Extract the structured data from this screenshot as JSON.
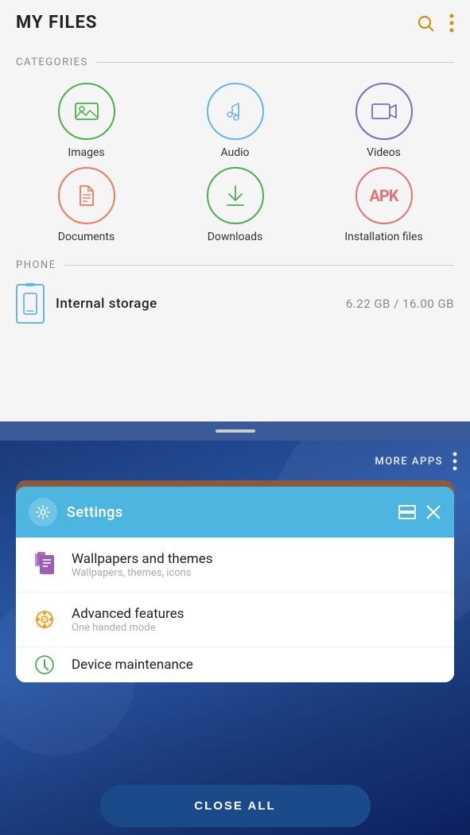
{
  "app": {
    "title": "MY FILES"
  },
  "header": {
    "search_icon": "🔍",
    "more_icon": "⋮"
  },
  "categories_section": {
    "label": "CATEGORIES",
    "items": [
      {
        "id": "images",
        "label": "Images",
        "color": "#4caf50"
      },
      {
        "id": "audio",
        "label": "Audio",
        "color": "#64b5f6"
      },
      {
        "id": "videos",
        "label": "Videos",
        "color": "#7c6bbf"
      },
      {
        "id": "documents",
        "label": "Documents",
        "color": "#ef7b5a"
      },
      {
        "id": "downloads",
        "label": "Downloads",
        "color": "#4caf50"
      },
      {
        "id": "installation",
        "label": "Installation files",
        "color": "#e57373"
      }
    ]
  },
  "phone_section": {
    "label": "PHONE",
    "storage": {
      "name": "Internal storage",
      "used": "6.22 GB",
      "total": "16.00 GB",
      "display": "6.22 GB / 16.00 GB"
    }
  },
  "recent_apps": {
    "more_apps_label": "MORE APPS",
    "settings_card": {
      "title": "Settings",
      "menu_items": [
        {
          "title": "Wallpapers and themes",
          "subtitle": "Wallpapers, themes, icons",
          "icon_color": "#9c5fb5"
        },
        {
          "title": "Advanced features",
          "subtitle": "One handed mode",
          "icon_color": "#e8a020"
        },
        {
          "title": "Device maintenance",
          "subtitle": "",
          "icon_color": "#4caf50"
        }
      ]
    },
    "close_all_label": "CLOSE ALL"
  }
}
